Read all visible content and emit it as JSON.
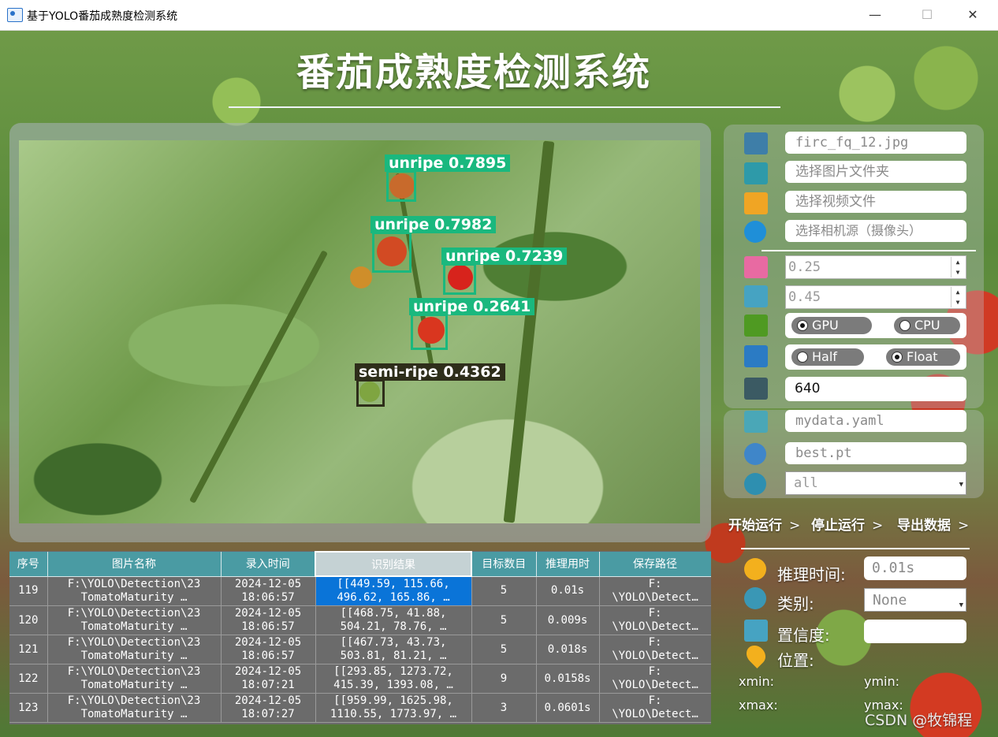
{
  "window": {
    "title": "基于YOLO番茄成熟度检测系统",
    "minimize": "—",
    "maximize": "☐",
    "close": "✕"
  },
  "header": {
    "title": "番茄成熟度检测系统"
  },
  "detections": [
    {
      "label": "unripe 0.7895",
      "class": "unripe"
    },
    {
      "label": "unripe 0.7982",
      "class": "unripe"
    },
    {
      "label": "unripe 0.7239",
      "class": "unripe"
    },
    {
      "label": "unripe 0.2641",
      "class": "unripe"
    },
    {
      "label": "semi-ripe 0.4362",
      "class": "semi-ripe"
    }
  ],
  "controls": {
    "image_file": "firc_fq_12.jpg",
    "image_folder": "选择图片文件夹",
    "video_file": "选择视频文件",
    "camera_source": "选择相机源（摄像头）",
    "confidence": "0.25",
    "iou": "0.45",
    "device_gpu": "GPU",
    "device_cpu": "CPU",
    "precision_half": "Half",
    "precision_float": "Float",
    "img_size": "640",
    "data_yaml": "mydata.yaml",
    "weights": "best.pt",
    "class_filter": "all",
    "selected_device": "GPU",
    "selected_precision": "Float"
  },
  "actions": {
    "start": "开始运行",
    "stop": "停止运行",
    "export": "导出数据",
    "chevron": ">"
  },
  "result": {
    "infer_time_label": "推理时间:",
    "infer_time_value": "0.01s",
    "class_label": "类别:",
    "class_value": "None",
    "conf_label": "置信度:",
    "conf_value": "",
    "position_label": "位置:",
    "xmin": "xmin:",
    "ymin": "ymin:",
    "xmax": "xmax:",
    "ymax": "ymax:"
  },
  "table": {
    "headers": [
      "序号",
      "图片名称",
      "录入时间",
      "识别结果",
      "目标数目",
      "推理用时",
      "保存路径"
    ],
    "rows": [
      {
        "id": "119",
        "name1": "F:\\YOLO\\Detection\\23",
        "name2": "TomatoMaturity …",
        "time1": "2024-12-05",
        "time2": "18:06:57",
        "res1": "[[449.59, 115.66,",
        "res2": "496.62, 165.86, …",
        "count": "5",
        "infer": "0.01s",
        "path1": "F:",
        "path2": "\\YOLO\\Detect…"
      },
      {
        "id": "120",
        "name1": "F:\\YOLO\\Detection\\23",
        "name2": "TomatoMaturity …",
        "time1": "2024-12-05",
        "time2": "18:06:57",
        "res1": "[[468.75, 41.88,",
        "res2": "504.21, 78.76, …",
        "count": "5",
        "infer": "0.009s",
        "path1": "F:",
        "path2": "\\YOLO\\Detect…"
      },
      {
        "id": "121",
        "name1": "F:\\YOLO\\Detection\\23",
        "name2": "TomatoMaturity …",
        "time1": "2024-12-05",
        "time2": "18:06:57",
        "res1": "[[467.73, 43.73,",
        "res2": "503.81, 81.21, …",
        "count": "5",
        "infer": "0.018s",
        "path1": "F:",
        "path2": "\\YOLO\\Detect…"
      },
      {
        "id": "122",
        "name1": "F:\\YOLO\\Detection\\23",
        "name2": "TomatoMaturity …",
        "time1": "2024-12-05",
        "time2": "18:07:21",
        "res1": "[[293.85, 1273.72,",
        "res2": "415.39, 1393.08, …",
        "count": "9",
        "infer": "0.0158s",
        "path1": "F:",
        "path2": "\\YOLO\\Detect…"
      },
      {
        "id": "123",
        "name1": "F:\\YOLO\\Detection\\23",
        "name2": "TomatoMaturity …",
        "time1": "2024-12-05",
        "time2": "18:07:27",
        "res1": "[[959.99, 1625.98,",
        "res2": "1110.55, 1773.97, …",
        "count": "3",
        "infer": "0.0601s",
        "path1": "F:",
        "path2": "\\YOLO\\Detect…"
      }
    ]
  },
  "watermark": "CSDN @牧锦程",
  "colors": {
    "detection_unripe": "#1ab87e",
    "detection_semi_ripe": "#2e2e1a",
    "table_header": "#4a9ba3",
    "selected_cell": "#0a74d8"
  }
}
